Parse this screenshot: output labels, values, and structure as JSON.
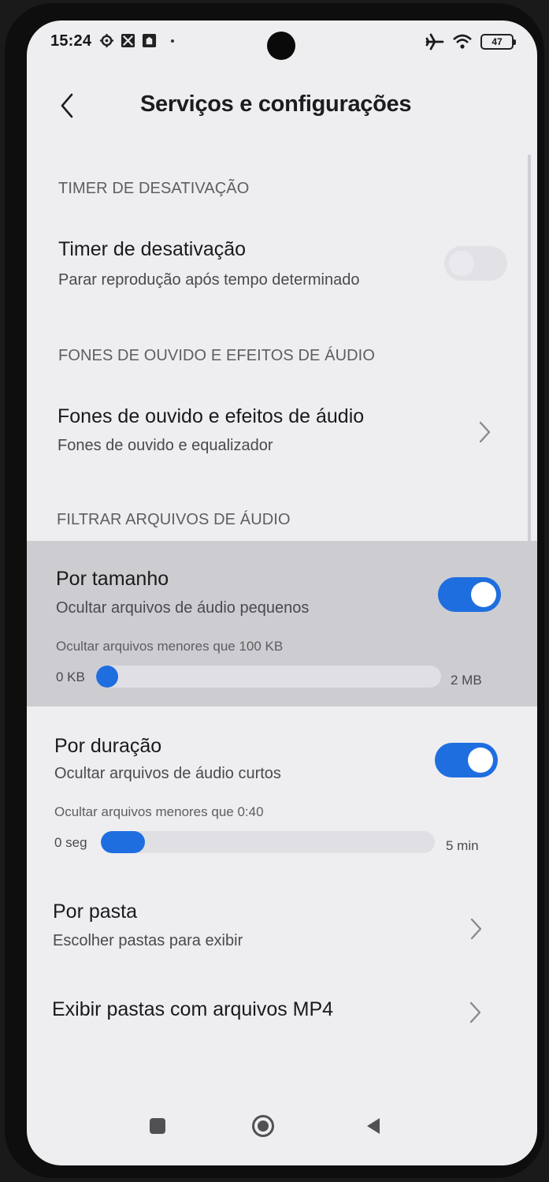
{
  "status_bar": {
    "time": "15:24",
    "battery_level": "47"
  },
  "header": {
    "title": "Serviços e configurações"
  },
  "sections": {
    "timer_header": "TIMER DE DESATIVAÇÃO",
    "timer_title": "Timer de desativação",
    "timer_sub": "Parar reprodução após tempo determinado",
    "headphones_header": "FONES DE OUVIDO E EFEITOS DE ÁUDIO",
    "headphones_title": "Fones de ouvido e efeitos de áudio",
    "headphones_sub": "Fones de ouvido e equalizador",
    "filter_header": "FILTRAR ARQUIVOS DE ÁUDIO",
    "size_title": "Por tamanho",
    "size_sub": "Ocultar arquivos de áudio pequenos",
    "size_caption": "Ocultar arquivos menores que 100 KB",
    "size_min": "0 KB",
    "size_max": "2 MB",
    "duration_title": "Por duração",
    "duration_sub": "Ocultar arquivos de áudio curtos",
    "duration_caption": "Ocultar arquivos menores que 0:40",
    "duration_min": "0 seg",
    "duration_max": "5 min",
    "folder_title": "Por pasta",
    "folder_sub": "Escolher pastas para exibir",
    "mp4_title": "Exibir pastas com arquivos MP4"
  },
  "toggles": {
    "timer_on": false,
    "size_on": true,
    "duration_on": true
  },
  "sliders": {
    "size_fraction": 0.05,
    "duration_fraction": 0.133
  },
  "colors": {
    "accent": "#1f6ee0",
    "background": "#eeeef1"
  }
}
